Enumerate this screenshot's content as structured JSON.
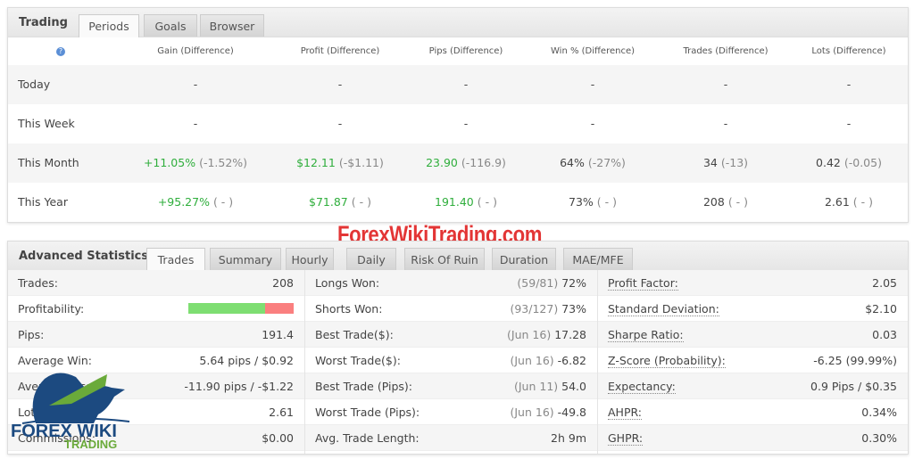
{
  "trading": {
    "title": "Trading",
    "tabs": [
      "Periods",
      "Goals",
      "Browser"
    ],
    "active_tab": "Periods",
    "columns": [
      "Gain (Difference)",
      "Profit (Difference)",
      "Pips (Difference)",
      "Win % (Difference)",
      "Trades (Difference)",
      "Lots (Difference)"
    ],
    "rows": [
      {
        "label": "Today",
        "cells": [
          {
            "v": "-",
            "d": ""
          },
          {
            "v": "-",
            "d": ""
          },
          {
            "v": "-",
            "d": ""
          },
          {
            "v": "-",
            "d": ""
          },
          {
            "v": "-",
            "d": ""
          },
          {
            "v": "-",
            "d": ""
          }
        ]
      },
      {
        "label": "This Week",
        "cells": [
          {
            "v": "-",
            "d": ""
          },
          {
            "v": "-",
            "d": ""
          },
          {
            "v": "-",
            "d": ""
          },
          {
            "v": "-",
            "d": ""
          },
          {
            "v": "-",
            "d": ""
          },
          {
            "v": "-",
            "d": ""
          }
        ]
      },
      {
        "label": "This Month",
        "cells": [
          {
            "v": "+11.05%",
            "d": "(-1.52%)"
          },
          {
            "v": "$12.11",
            "d": "(-$1.11)"
          },
          {
            "v": "23.90",
            "d": "(-116.9)"
          },
          {
            "v": "64%",
            "d": "(-27%)"
          },
          {
            "v": "34",
            "d": "(-13)"
          },
          {
            "v": "0.42",
            "d": "(-0.05)"
          }
        ]
      },
      {
        "label": "This Year",
        "cells": [
          {
            "v": "+95.27%",
            "d": "( - )"
          },
          {
            "v": "$71.87",
            "d": "( - )"
          },
          {
            "v": "191.40",
            "d": "( - )"
          },
          {
            "v": "73%",
            "d": "( - )"
          },
          {
            "v": "208",
            "d": "( - )"
          },
          {
            "v": "2.61",
            "d": "( - )"
          }
        ]
      }
    ]
  },
  "advanced": {
    "title": "Advanced Statistics",
    "tabs": [
      "Trades",
      "Summary",
      "Hourly",
      "Daily",
      "Risk Of Ruin",
      "Duration",
      "MAE/MFE"
    ],
    "active_tab": "Trades",
    "col1": [
      {
        "l": "Trades:",
        "v": "208"
      },
      {
        "l": "Profitability:",
        "v": ""
      },
      {
        "l": "Pips:",
        "v": "191.4"
      },
      {
        "l": "Average Win:",
        "v": "5.64 pips / $0.92"
      },
      {
        "l": "Average Loss:",
        "v": "-11.90 pips / -$1.22"
      },
      {
        "l": "Lots:",
        "v": "2.61"
      },
      {
        "l": "Commissions:",
        "v": "$0.00"
      }
    ],
    "profitability_win_pct": 73,
    "col2": [
      {
        "l": "Longs Won:",
        "d": "(59/81)",
        "v": "72%"
      },
      {
        "l": "Shorts Won:",
        "d": "(93/127)",
        "v": "73%"
      },
      {
        "l": "Best Trade($):",
        "d": "(Jun 16)",
        "v": "17.28"
      },
      {
        "l": "Worst Trade($):",
        "d": "(Jun 16)",
        "v": "-6.82"
      },
      {
        "l": "Best Trade (Pips):",
        "d": "(Jun 11)",
        "v": "54.0"
      },
      {
        "l": "Worst Trade (Pips):",
        "d": "(Jun 16)",
        "v": "-49.8"
      },
      {
        "l": "Avg. Trade Length:",
        "d": "",
        "v": "2h 9m"
      }
    ],
    "col3": [
      {
        "l": "Profit Factor:",
        "v": "2.05"
      },
      {
        "l": "Standard Deviation:",
        "v": "$2.10"
      },
      {
        "l": "Sharpe Ratio:",
        "v": "0.03"
      },
      {
        "l": "Z-Score (Probability):",
        "v": "-6.25 (99.99%)"
      },
      {
        "l": "Expectancy:",
        "v": "0.9 Pips / $0.35"
      },
      {
        "l": "AHPR:",
        "v": "0.34%"
      },
      {
        "l": "GHPR:",
        "v": "0.30%"
      }
    ]
  },
  "watermark": "ForexWikiTrading.com",
  "logo": {
    "line1": "FOREX WIKI",
    "line2": "TRADING"
  },
  "colors": {
    "positive": "#2fae3c",
    "win_bar": "#7ede72",
    "loss_bar": "#fa7f7f",
    "watermark": "#e02020"
  }
}
